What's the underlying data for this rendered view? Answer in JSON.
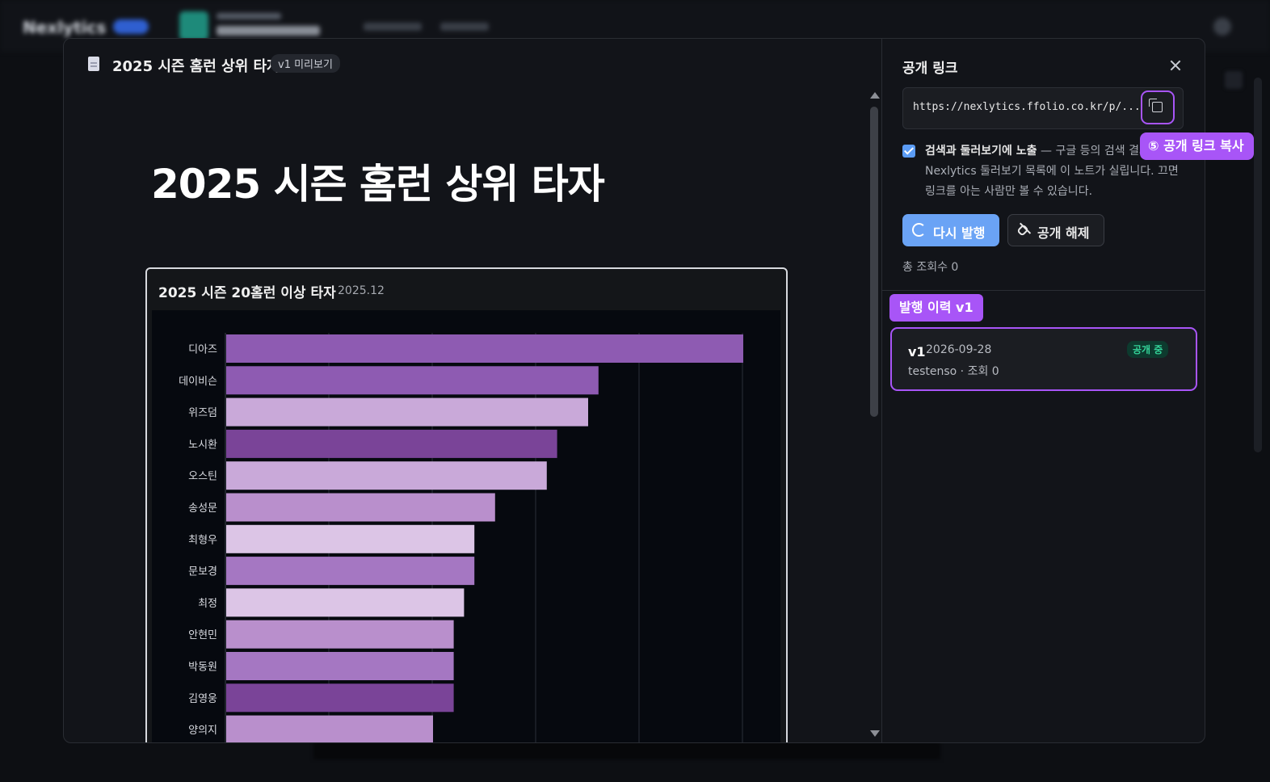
{
  "background": {
    "logo": "Nexlytics"
  },
  "preview": {
    "title": "2025 시즌 홈런 상위 타자",
    "version_badge": "v1 미리보기",
    "doc_heading": "2025 시즌 홈런 상위 타자"
  },
  "chart_card": {
    "title": "2025 시즌 20홈런 이상 타자",
    "date": "2025.12"
  },
  "chart_data": {
    "type": "bar",
    "orientation": "horizontal",
    "categories": [
      "디아즈",
      "데이비슨",
      "위즈덤",
      "노시환",
      "오스틴",
      "송성문",
      "최형우",
      "문보경",
      "최정",
      "안현민",
      "박동원",
      "김영웅",
      "양의지"
    ],
    "values": [
      50,
      36,
      35,
      32,
      31,
      26,
      24,
      24,
      23,
      22,
      22,
      22,
      20
    ],
    "colors": [
      "#8e5bb2",
      "#8e5bb2",
      "#c9a9d9",
      "#7a4498",
      "#c9a9d9",
      "#b98fcc",
      "#dcc5e6",
      "#a577c2",
      "#dcc5e6",
      "#b98fcc",
      "#a577c2",
      "#7a4498",
      "#b98fcc"
    ],
    "xlim": [
      0,
      50
    ],
    "grid": true
  },
  "panel": {
    "title": "공개 링크",
    "url": "https://nexlytics.ffolio.co.kr/p/...",
    "callout_copy": "⑤ 공개 링크 복사",
    "checkbox_bold": "검색과 둘러보기에 노출",
    "checkbox_desc": " — 구글 등의 검색 결과와 Nexlytics 둘러보기 목록에 이 노트가 실립니다. 끄면 링크를 아는 사람만 볼 수 있습니다.",
    "republish_label": "다시 발행",
    "unpublish_label": "공개 해제",
    "total_views": "총 조회수 0",
    "history_callout": "발행 이력 v1",
    "history": {
      "version": "v1",
      "date": "2026-09-28",
      "status": "공개 중",
      "meta": "testenso · 조회 0"
    }
  },
  "colors": {
    "accent": "#a855f7",
    "primary_button": "#6aa3f5",
    "status_green": "#34d399"
  }
}
